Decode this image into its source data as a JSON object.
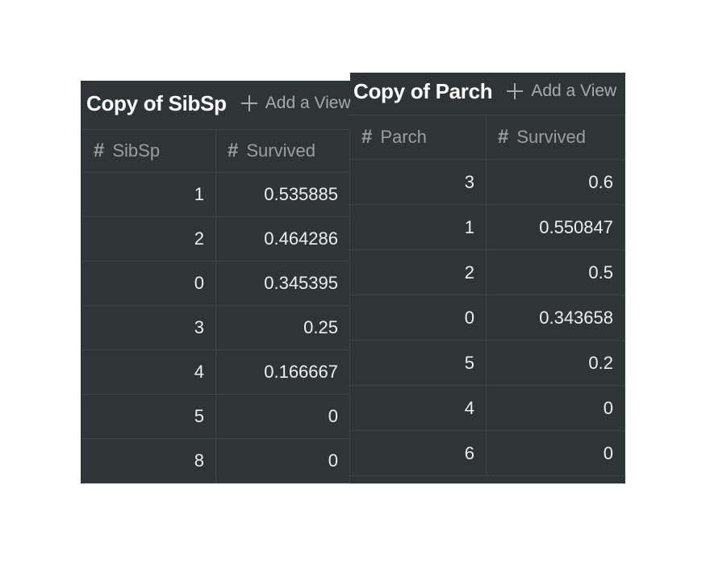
{
  "left_view": {
    "title": "Copy of SibSp",
    "add_view_label": "Add a View",
    "columns": [
      "SibSp",
      "Survived"
    ],
    "rows": [
      [
        "1",
        "0.535885"
      ],
      [
        "2",
        "0.464286"
      ],
      [
        "0",
        "0.345395"
      ],
      [
        "3",
        "0.25"
      ],
      [
        "4",
        "0.166667"
      ],
      [
        "5",
        "0"
      ],
      [
        "8",
        "0"
      ]
    ]
  },
  "right_view": {
    "title": "Copy of Parch",
    "add_view_label": "Add a View",
    "columns": [
      "Parch",
      "Survived"
    ],
    "rows": [
      [
        "3",
        "0.6"
      ],
      [
        "1",
        "0.550847"
      ],
      [
        "2",
        "0.5"
      ],
      [
        "0",
        "0.343658"
      ],
      [
        "5",
        "0.2"
      ],
      [
        "4",
        "0"
      ],
      [
        "6",
        "0"
      ]
    ]
  },
  "icons": {
    "column_type": "hash-icon",
    "add": "plus-icon"
  },
  "colors": {
    "panel_bg": "#2f3437",
    "grid_line": "#3f4447",
    "header_text": "#9b9d9e",
    "title_text": "#ffffff"
  }
}
